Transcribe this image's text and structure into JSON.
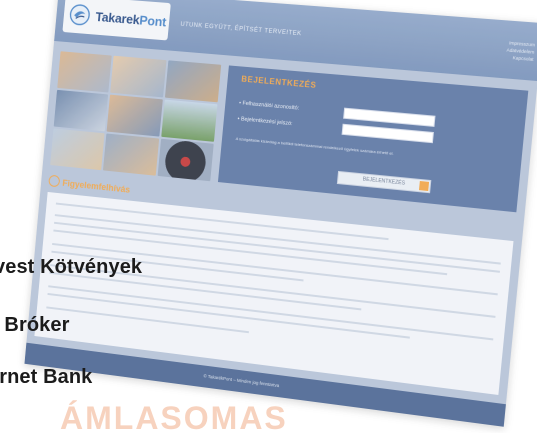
{
  "brand": {
    "logo_text_main": "Takarek",
    "logo_text_accent": "Pont"
  },
  "header": {
    "tagline": "UTUNK EGYÜTT, ÉPÍTSÉT TERVEITEK",
    "links": [
      "Impresszum",
      "Adatvédelem",
      "Kapcsolat"
    ]
  },
  "login": {
    "title": "BEJELENTKEZÉS",
    "username_label": "• Felhasználói azonosító:",
    "password_label": "• Bejelentkezési jelszó:",
    "note": "A szolgáltatás kizárólag a belföldi telefonszámmal rendelkező ügyfelek számára érhető el.",
    "button_label": "BEJELENTKEZÉS"
  },
  "section": {
    "title": "Figyelemfelhívás"
  },
  "footer": {
    "text": "© TakarékPont – Minden jog fenntartva"
  },
  "overlay": {
    "line1": "vest Kötvények",
    "line2": "t Bróker",
    "line3": "ernet Bank",
    "bottom_text": "ÁMLASOMAS"
  },
  "colors": {
    "header": "#7a93ba",
    "panel": "#5e78a5",
    "accent": "#f0a64a",
    "overlay_text": "#1b1b1b",
    "bottom_text": "#f6cbb3"
  }
}
